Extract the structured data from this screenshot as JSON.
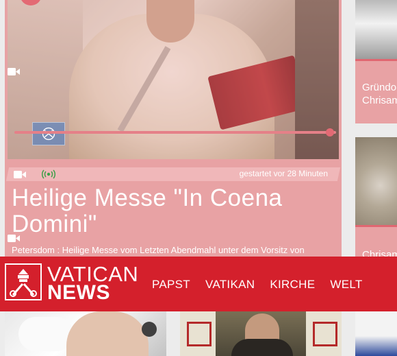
{
  "feature": {
    "started_prefix": "gestartet vor",
    "started_value": "28 Minuten",
    "title": "Heilige Messe \"In Coena Domini\"",
    "description": "Petersdom : Heilige Messe vom Letzten Abendmahl unter dem Vorsitz von",
    "media_type_icon": "video-camera-icon",
    "live_icon": "broadcast-icon",
    "playback_progress": 0.98
  },
  "side": {
    "card1": {
      "line1": "Gründo",
      "line2": "Chrisam",
      "icon": "video-camera-icon"
    },
    "card2": {
      "line1": "Chrisam",
      "icon": "video-camera-icon"
    }
  },
  "header": {
    "logo_top": "VATICAN",
    "logo_bottom": "NEWS",
    "nav": [
      "PAPST",
      "VATIKAN",
      "KIRCHE",
      "WELT"
    ]
  },
  "colors": {
    "brand_red": "#d4202c",
    "card_pink": "#e8a2a4",
    "accent": "#e06771"
  }
}
